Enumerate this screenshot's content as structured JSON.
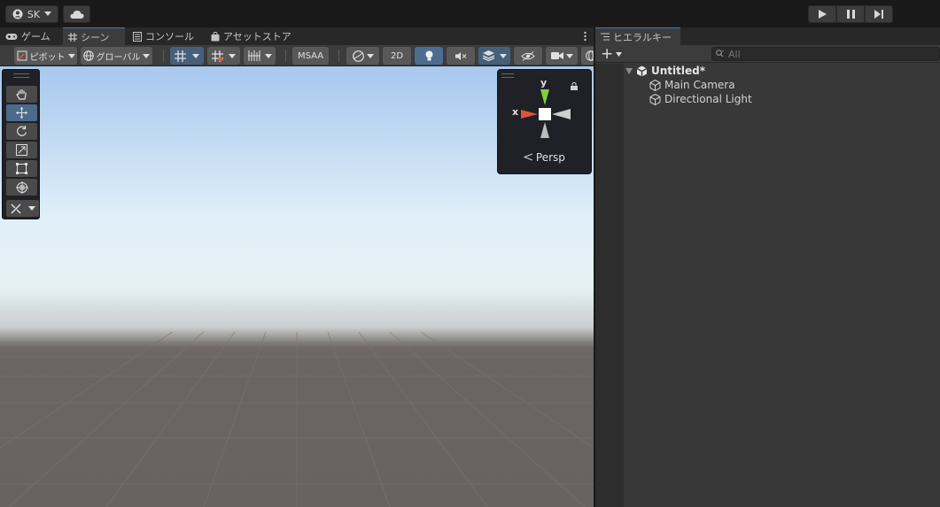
{
  "topbar": {
    "account_label": "SK",
    "account_icon": "user-icon",
    "cloud_icon": "cloud-icon",
    "play_icon": "play-icon",
    "pause_icon": "pause-icon",
    "step_icon": "step-icon"
  },
  "tabs": [
    {
      "label": "ゲーム",
      "icon": "gamepad-icon"
    },
    {
      "label": "シーン",
      "icon": "grid-hash-icon"
    },
    {
      "label": "コンソール",
      "icon": "console-icon"
    },
    {
      "label": "アセットストア",
      "icon": "bag-icon"
    }
  ],
  "active_tab": "シーン",
  "scene_toolbar": {
    "pivot_label": "ピボット",
    "global_label": "グローバル",
    "msaa_label": "MSAA",
    "mode_2d_label": "2D"
  },
  "gizmo": {
    "y_label": "y",
    "x_label": "x",
    "persp_label": "Persp",
    "colors": {
      "x": "#e0523c",
      "y": "#7ed23b",
      "z": "#cfcfcf"
    }
  },
  "hierarchy": {
    "tab_label": "ヒエラルキー",
    "search_placeholder": "All",
    "add_label": "+",
    "scene_name": "Untitled*",
    "items": [
      {
        "label": "Main Camera"
      },
      {
        "label": "Directional Light"
      }
    ]
  },
  "colors": {
    "accent": "#3a79bb",
    "panel": "#383838",
    "toolbar": "#3c3c3c"
  }
}
